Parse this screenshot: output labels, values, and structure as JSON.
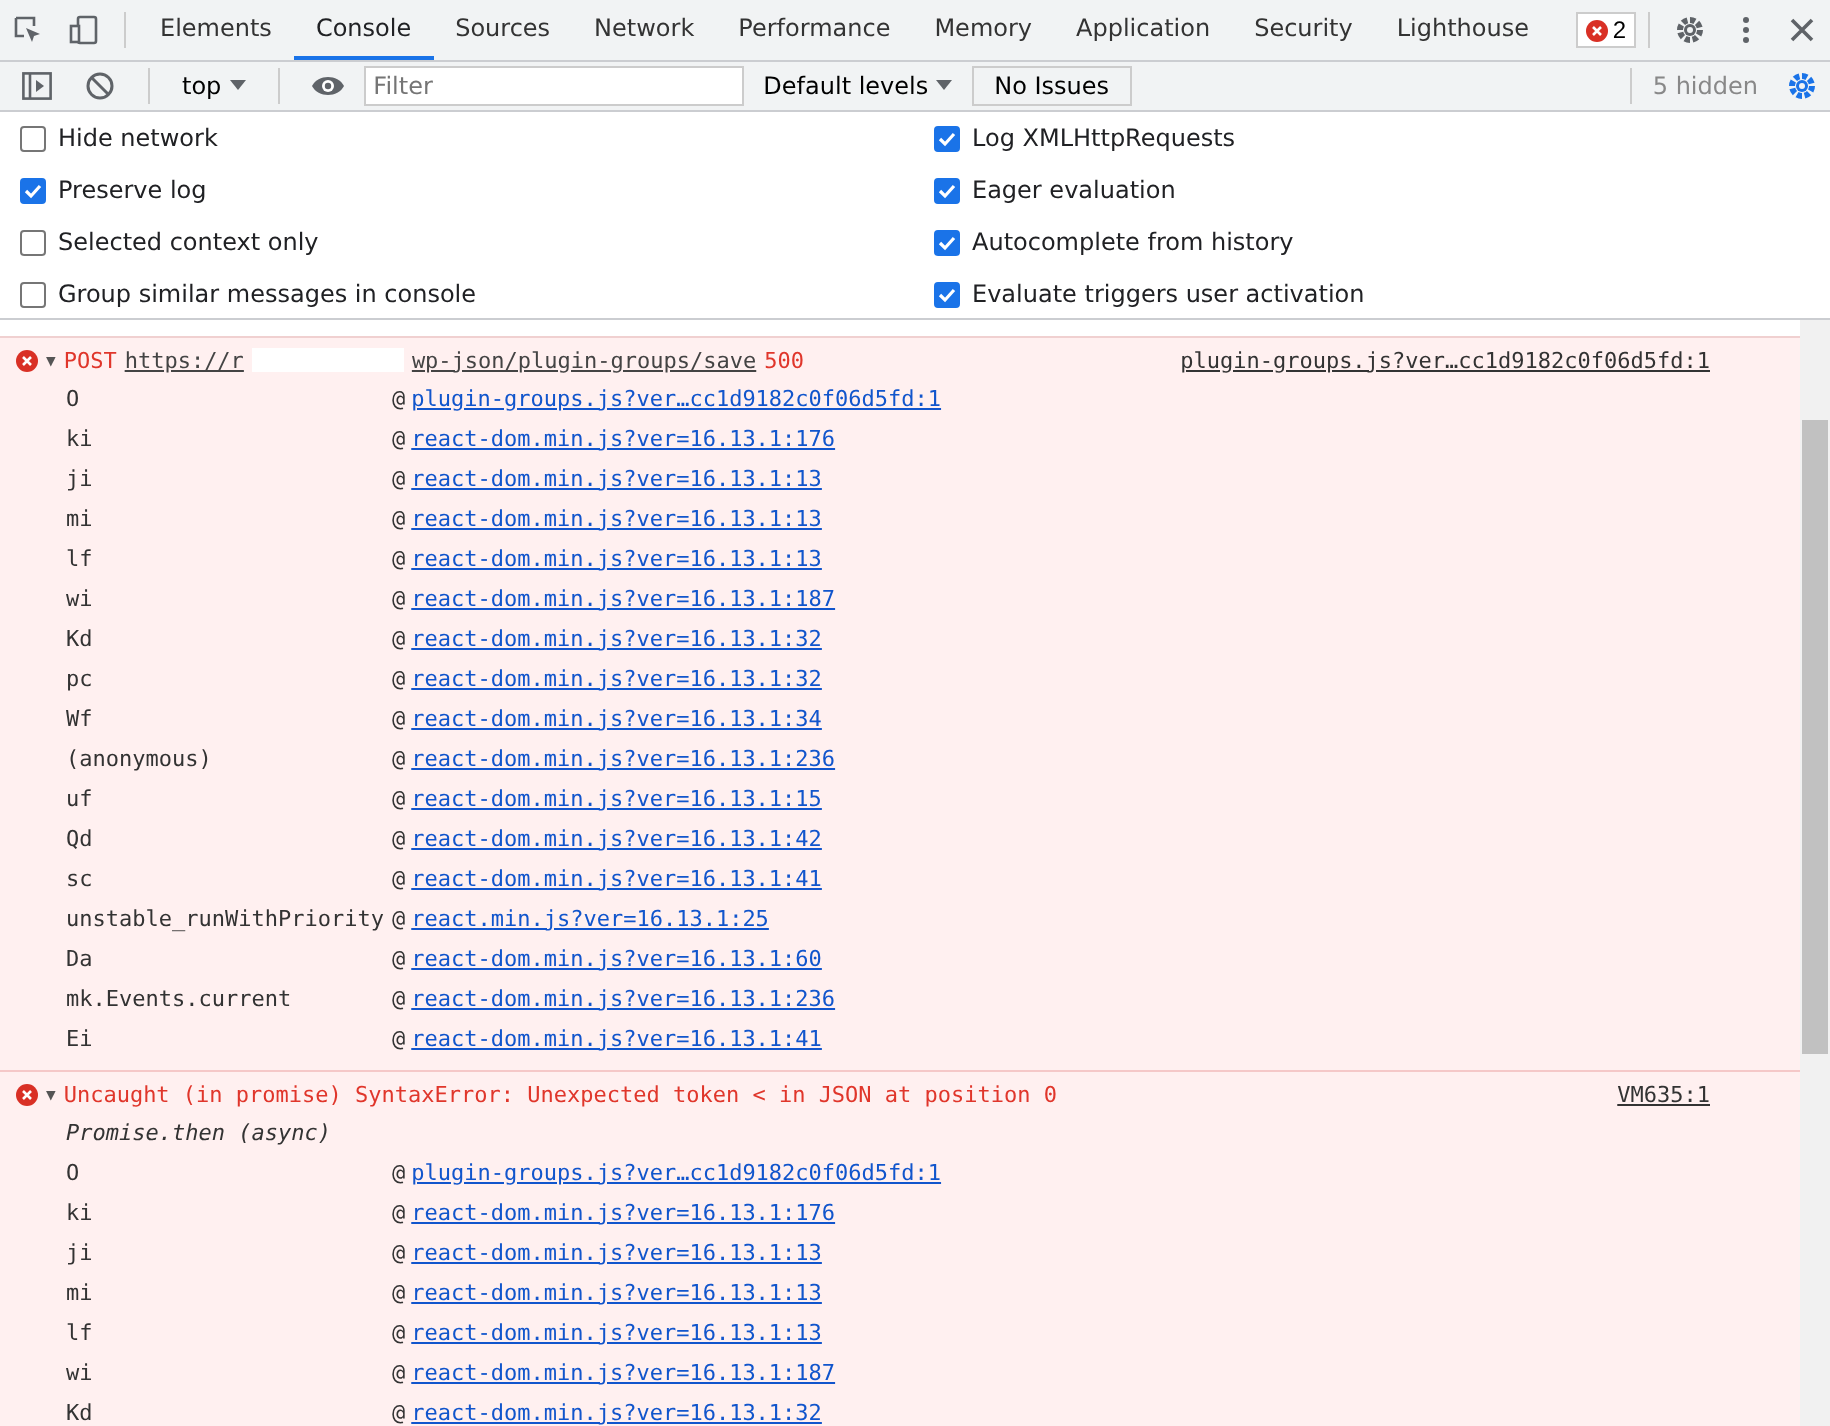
{
  "tabs": [
    {
      "label": "Elements",
      "selected": false
    },
    {
      "label": "Console",
      "selected": true
    },
    {
      "label": "Sources",
      "selected": false
    },
    {
      "label": "Network",
      "selected": false
    },
    {
      "label": "Performance",
      "selected": false
    },
    {
      "label": "Memory",
      "selected": false
    },
    {
      "label": "Application",
      "selected": false
    },
    {
      "label": "Security",
      "selected": false
    },
    {
      "label": "Lighthouse",
      "selected": false
    }
  ],
  "error_count": "2",
  "toolbar": {
    "context": "top",
    "filter_placeholder": "Filter",
    "levels": "Default levels",
    "issues": "No Issues",
    "hidden": "5 hidden"
  },
  "settings": [
    {
      "label": "Hide network",
      "checked": false
    },
    {
      "label": "Log XMLHttpRequests",
      "checked": true
    },
    {
      "label": "Preserve log",
      "checked": true
    },
    {
      "label": "Eager evaluation",
      "checked": true
    },
    {
      "label": "Selected context only",
      "checked": false
    },
    {
      "label": "Autocomplete from history",
      "checked": true
    },
    {
      "label": "Group similar messages in console",
      "checked": false
    },
    {
      "label": "Evaluate triggers user activation",
      "checked": true
    }
  ],
  "messages": [
    {
      "toggle": "▼",
      "text_start": "POST",
      "url_start": "https://r",
      "url_end": "wp-json/plugin-groups/save",
      "status": "500",
      "source": "plugin-groups.js?ver…cc1d9182c0f06d5fd:1",
      "stack": [
        {
          "fn": "O",
          "at": "@",
          "link": "plugin-groups.js?ver…cc1d9182c0f06d5fd:1"
        },
        {
          "fn": "ki",
          "at": "@",
          "link": "react-dom.min.js?ver=16.13.1:176"
        },
        {
          "fn": "ji",
          "at": "@",
          "link": "react-dom.min.js?ver=16.13.1:13"
        },
        {
          "fn": "mi",
          "at": "@",
          "link": "react-dom.min.js?ver=16.13.1:13"
        },
        {
          "fn": "lf",
          "at": "@",
          "link": "react-dom.min.js?ver=16.13.1:13"
        },
        {
          "fn": "wi",
          "at": "@",
          "link": "react-dom.min.js?ver=16.13.1:187"
        },
        {
          "fn": "Kd",
          "at": "@",
          "link": "react-dom.min.js?ver=16.13.1:32"
        },
        {
          "fn": "pc",
          "at": "@",
          "link": "react-dom.min.js?ver=16.13.1:32"
        },
        {
          "fn": "Wf",
          "at": "@",
          "link": "react-dom.min.js?ver=16.13.1:34"
        },
        {
          "fn": "(anonymous)",
          "at": "@",
          "link": "react-dom.min.js?ver=16.13.1:236"
        },
        {
          "fn": "uf",
          "at": "@",
          "link": "react-dom.min.js?ver=16.13.1:15"
        },
        {
          "fn": "Qd",
          "at": "@",
          "link": "react-dom.min.js?ver=16.13.1:42"
        },
        {
          "fn": "sc",
          "at": "@",
          "link": "react-dom.min.js?ver=16.13.1:41"
        },
        {
          "fn": "unstable_runWithPriority",
          "at": "@",
          "link": "react.min.js?ver=16.13.1:25"
        },
        {
          "fn": "Da",
          "at": "@",
          "link": "react-dom.min.js?ver=16.13.1:60"
        },
        {
          "fn": "mk.Events.current",
          "at": "@",
          "link": "react-dom.min.js?ver=16.13.1:236"
        },
        {
          "fn": "Ei",
          "at": "@",
          "link": "react-dom.min.js?ver=16.13.1:41"
        }
      ]
    },
    {
      "toggle": "▼",
      "text_start": "Uncaught (in promise) SyntaxError: Unexpected token < in JSON at position 0",
      "source": "VM635:1",
      "async_note": "Promise.then (async)",
      "stack": [
        {
          "fn": "O",
          "at": "@",
          "link": "plugin-groups.js?ver…cc1d9182c0f06d5fd:1"
        },
        {
          "fn": "ki",
          "at": "@",
          "link": "react-dom.min.js?ver=16.13.1:176"
        },
        {
          "fn": "ji",
          "at": "@",
          "link": "react-dom.min.js?ver=16.13.1:13"
        },
        {
          "fn": "mi",
          "at": "@",
          "link": "react-dom.min.js?ver=16.13.1:13"
        },
        {
          "fn": "lf",
          "at": "@",
          "link": "react-dom.min.js?ver=16.13.1:13"
        },
        {
          "fn": "wi",
          "at": "@",
          "link": "react-dom.min.js?ver=16.13.1:187"
        },
        {
          "fn": "Kd",
          "at": "@",
          "link": "react-dom.min.js?ver=16.13.1:32"
        }
      ]
    }
  ]
}
